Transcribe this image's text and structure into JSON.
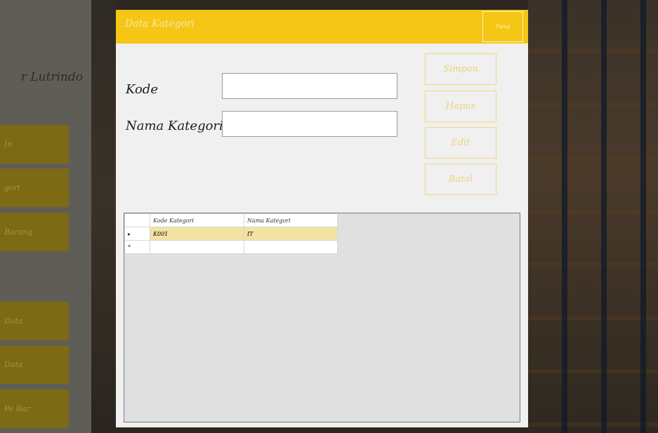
{
  "background_app": {
    "title": "r Lutrindo",
    "menu_buttons": [
      "In",
      "gori",
      "Barang",
      "",
      "Data",
      "Data",
      "Pe Bar"
    ]
  },
  "dialog": {
    "title": "Data Kategori",
    "close_label": "Tutup",
    "fields": {
      "kode": {
        "label": "Kode",
        "value": ""
      },
      "nama_kategori": {
        "label": "Nama Kategori",
        "value": ""
      }
    },
    "buttons": {
      "simpan": "Simpan",
      "hapus": "Hapus",
      "edit": "Edit",
      "batal": "Batal"
    },
    "grid": {
      "columns": [
        "Kode Kategori",
        "Nama Kategori"
      ],
      "rows": [
        {
          "marker": "▸",
          "kode": "K001",
          "nama": "IT"
        }
      ],
      "new_row_marker": "*"
    }
  }
}
